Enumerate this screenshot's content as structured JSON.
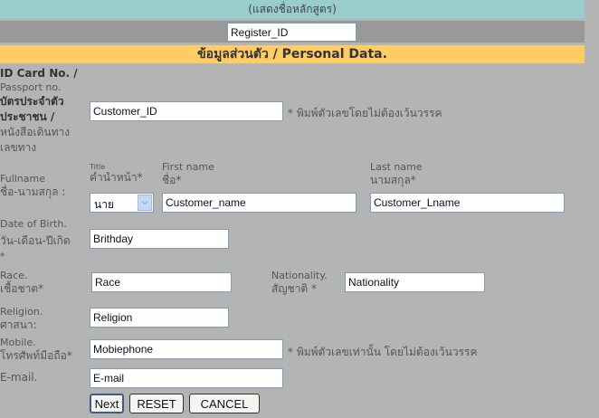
{
  "header": {
    "course_name": "(แสดงชื่อหลักสูตร)",
    "register_id": "Register_ID",
    "section_title": "ข้อมูลส่วนตัว / Personal Data."
  },
  "form": {
    "id_card": {
      "label_en1": "ID Card No. /",
      "label_en2": "Passport no.",
      "label_th1": "บัตรประจำตัว",
      "label_th2": "ประชาชน /",
      "label_th3": "หนังสือเดินทาง",
      "label_th4": "เลขทาง",
      "value": "Customer_ID",
      "note": "* พิมพ์ตัวเลขโดยไม่ต้องเว้นวรรค"
    },
    "fullname": {
      "label_en": "Fullname",
      "label_th": "ชื่อ-นามสกุล :",
      "title_label_en": "Title",
      "title_label_th": "คำนำหน้า*",
      "title_value": "นาย",
      "first_label_en": "First name",
      "first_label_th": "ชื่อ*",
      "first_value": "Customer_name",
      "last_label_en": "Last name",
      "last_label_th": "นามสกุล*",
      "last_value": "Customer_Lname"
    },
    "dob": {
      "label_en": "Date of Birth.",
      "label_th": "วัน-เดือน-ปีเกิด",
      "required": "*",
      "value": "Brithday"
    },
    "race": {
      "label_en": "Race.",
      "label_th": "เชื้อชาต*",
      "value": "Race"
    },
    "nationality": {
      "label_en": "Nationality.",
      "label_th": "สัญชาติ *",
      "value": "Nationality"
    },
    "religion": {
      "label_en": "Religion.",
      "label_th": "ศาสนา:",
      "value": "Religion"
    },
    "mobile": {
      "label_en": "Mobile.",
      "label_th": "โทรศัพท์มือถือ*",
      "value": "Mobiephone",
      "note": "* พิมพ์ตัวเลขเท่านั้น โดยไม่ต้องเว้นวรรค"
    },
    "email": {
      "label": "E-mail.",
      "value": "E-mail"
    }
  },
  "buttons": {
    "next": "Next",
    "reset": "RESET",
    "cancel": "CANCEL"
  }
}
